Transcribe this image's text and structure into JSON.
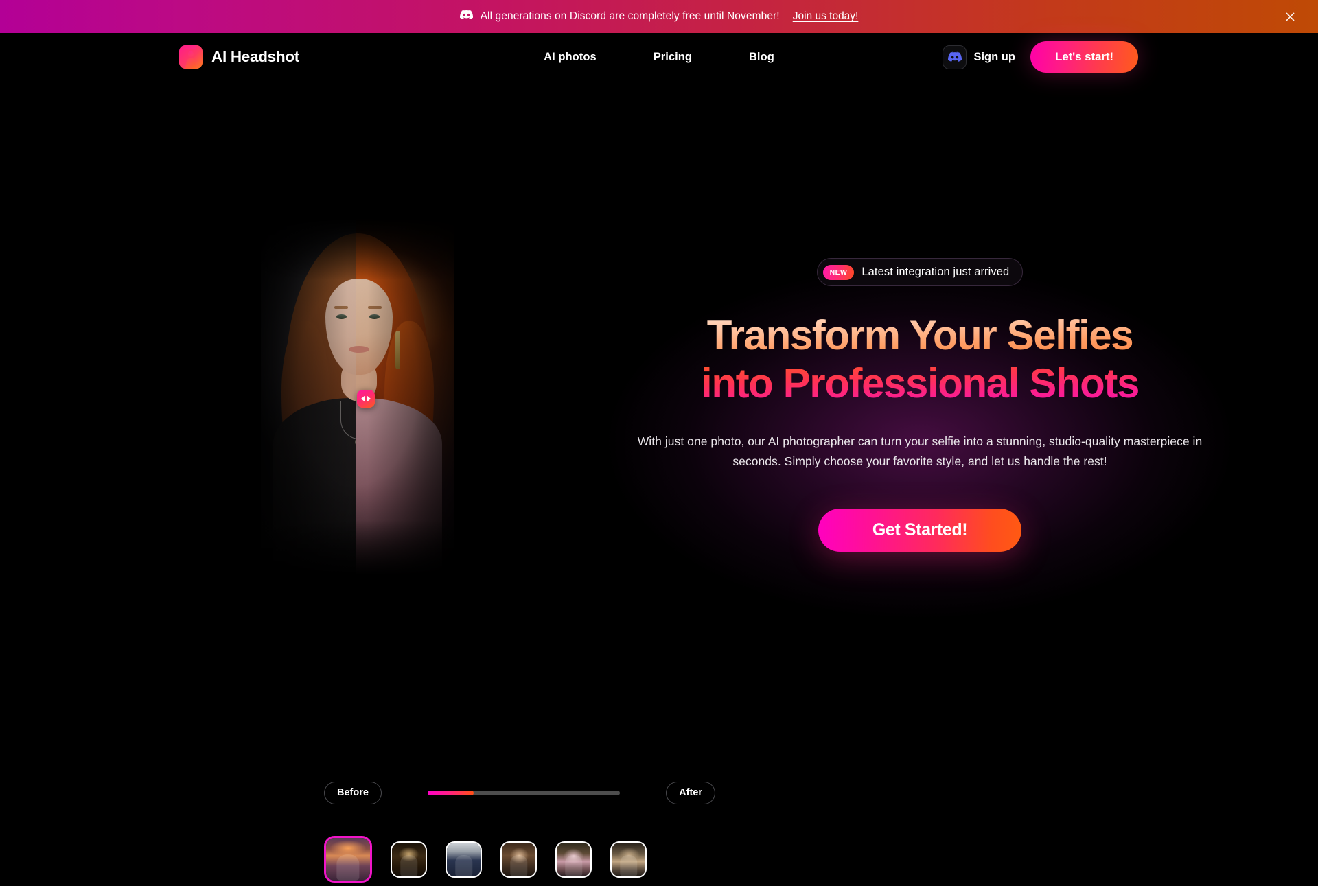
{
  "announcement": {
    "icon": "discord-icon",
    "text": "All generations on Discord are completely free until November!",
    "link_label": "Join us today!",
    "close_label": "×",
    "gradient_from": "#b30096",
    "gradient_to": "#bf4a05"
  },
  "header": {
    "brand_name": "AI Headshot",
    "brand_icon": "ai-headshot-logo-icon",
    "nav": [
      {
        "label": "AI photos"
      },
      {
        "label": "Pricing"
      },
      {
        "label": "Blog"
      }
    ],
    "discord_icon": "discord-icon",
    "signup_label": "Sign up",
    "cta_label": "Let's start!"
  },
  "hero": {
    "badge": {
      "chip": "NEW",
      "text": "Latest integration just arrived"
    },
    "headline_line_1": "Transform Your Selfies",
    "headline_line_2": "into Professional Shots",
    "subtext": "With just one photo, our AI photographer can turn your selfie into a stunning, studio-quality masterpiece in seconds. Simply choose your favorite style, and let us handle the rest!",
    "cta_label": "Get Started!",
    "accent_pink": "#ff00c0",
    "accent_orange": "#ff5a12"
  },
  "comparison": {
    "before_label": "Before",
    "after_label": "After",
    "progress_percent": 24,
    "handle_icon": "left-right-arrows-icon",
    "thumbnails": [
      {
        "name": "style-sunset-portrait",
        "selected": true,
        "art_class": "ta-1"
      },
      {
        "name": "style-candlelit-gothic",
        "selected": false,
        "art_class": "ta-2"
      },
      {
        "name": "style-business-suit",
        "selected": false,
        "art_class": "ta-3"
      },
      {
        "name": "style-warm-doorway",
        "selected": false,
        "art_class": "ta-4"
      },
      {
        "name": "style-royal-portrait",
        "selected": false,
        "art_class": "ta-5"
      },
      {
        "name": "style-street-fashion",
        "selected": false,
        "art_class": "ta-6"
      }
    ]
  }
}
